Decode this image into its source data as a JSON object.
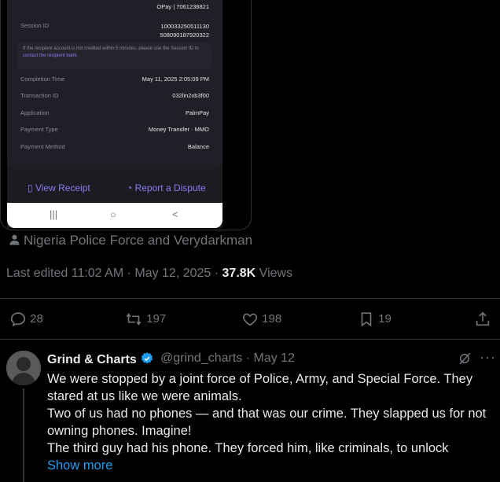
{
  "receipt": {
    "top_value": "OPay | 7061238821",
    "rows": [
      {
        "label": "Session ID",
        "value_line1": "100033250511130",
        "value_line2": "508090187920322"
      },
      {
        "label": "Completion Time",
        "value": "May 11, 2025 2:05:09 PM"
      },
      {
        "label": "Transaction ID",
        "value": "032lin2xb3f00"
      },
      {
        "label": "Application",
        "value": "PalmPay"
      },
      {
        "label": "Payment Type",
        "value": "Money Transfer · MMO"
      },
      {
        "label": "Payment Method",
        "value": "Balance"
      }
    ],
    "notice_text": "If the recipient account is not credited within 5 minutes, please use the Session ID to",
    "notice_link": "contact the recipient bank.",
    "view_receipt": "View Receipt",
    "report_dispute": "Report a Dispute",
    "nav": [
      "|||",
      "○",
      "<"
    ]
  },
  "tagged": "Nigeria Police Force and Verydarkman",
  "meta": {
    "edited": "Last edited 11:02 AM · May 12, 2025 · ",
    "views_count": "37.8K",
    "views_label": " Views"
  },
  "actions": {
    "replies": "28",
    "reposts": "197",
    "likes": "198",
    "bookmarks": "19"
  },
  "reply": {
    "name": "Grind & Charts",
    "handle": "@grind_charts · May 12",
    "lines": [
      "We were stopped by a joint force of Police, Army, and Special Force. They stared at us like we were animals.",
      "Two of us had no phones — and that was our crime. They slapped us for not owning phones. Imagine!",
      "The third guy had his phone. They forced him, like criminals, to unlock"
    ],
    "show_more": "Show more"
  },
  "colors": {
    "background": "#000000",
    "text": "#e7e9ea",
    "muted": "#71767b",
    "link": "#1d9bf0",
    "verified": "#1d9bf0",
    "divider": "#2f3336"
  }
}
